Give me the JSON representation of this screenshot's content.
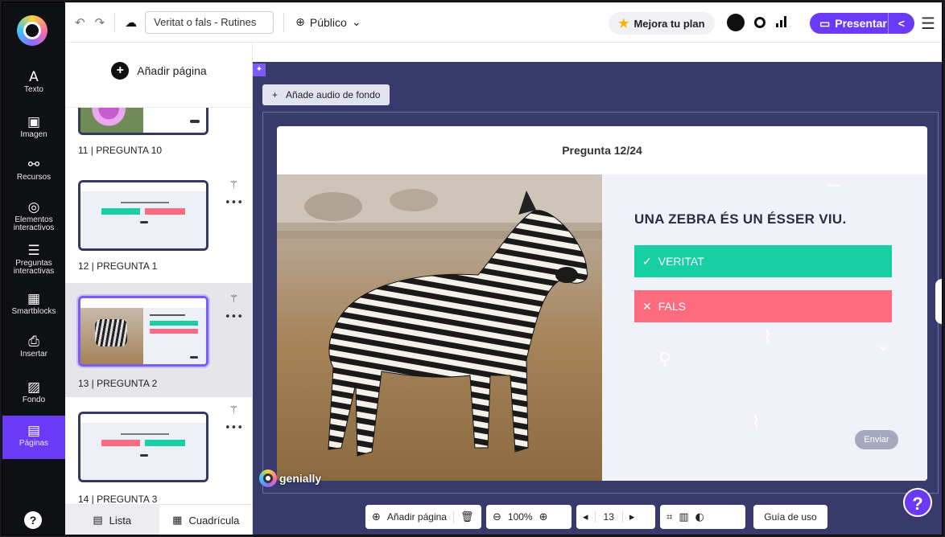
{
  "topbar": {
    "title": "Veritat o fals - Rutines",
    "visibility": "Público",
    "plan": "Mejora tu plan",
    "present": "Presentar"
  },
  "rail": {
    "items": [
      {
        "label": "Texto",
        "icon": "A"
      },
      {
        "label": "Imagen",
        "icon": "🖼"
      },
      {
        "label": "Recursos",
        "icon": "⚬"
      },
      {
        "label": "Elementos interactivos",
        "icon": "◎"
      },
      {
        "label": "Preguntas interactivas",
        "icon": "☰"
      },
      {
        "label": "Smartblocks",
        "icon": "▦"
      },
      {
        "label": "Insertar",
        "icon": "⎙"
      },
      {
        "label": "Fondo",
        "icon": "▨"
      },
      {
        "label": "Páginas",
        "icon": "▤"
      }
    ]
  },
  "panel": {
    "add_page": "Añadir página",
    "pages": [
      {
        "label": "11 | PREGUNTA 10"
      },
      {
        "label": "12 | PREGUNTA 1"
      },
      {
        "label": "13 | PREGUNTA 2"
      },
      {
        "label": "14 | PREGUNTA 3"
      }
    ],
    "view_list": "Lista",
    "view_grid": "Cuadrícula"
  },
  "stage": {
    "audio": "Añade audio de fondo",
    "slide_title": "Pregunta 12/24",
    "question": "UNA ZEBRA ÉS UN ÉSSER VIU.",
    "answer_true": "VERITAT",
    "answer_false": "FALS",
    "send": "Enviar",
    "brand": "genially"
  },
  "bottom": {
    "add_page": "Añadir página",
    "zoom": "100%",
    "page_number": "13",
    "guide": "Guía de uso"
  },
  "colors": {
    "accent": "#6b3af6",
    "true": "#17d1a4",
    "false": "#ff6b7e",
    "stage": "#373a6a"
  }
}
